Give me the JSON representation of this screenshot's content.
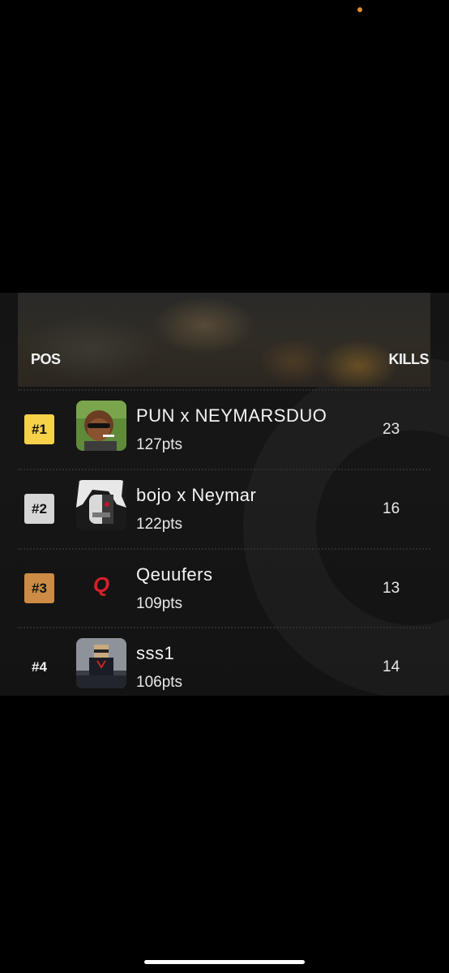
{
  "leaderboard": {
    "header": {
      "pos_label": "POS",
      "kills_label": "KILLS"
    },
    "rows": [
      {
        "rank": "#1",
        "team": "PUN x NEYMARSDUO",
        "points": "127pts",
        "kills": "23",
        "badge": "gold"
      },
      {
        "rank": "#2",
        "team": "bojo x Neymar",
        "points": "122pts",
        "kills": "16",
        "badge": "silver"
      },
      {
        "rank": "#3",
        "team": "Qeuufers",
        "points": "109pts",
        "kills": "13",
        "badge": "bronze"
      },
      {
        "rank": "#4",
        "team": "sss1",
        "points": "106pts",
        "kills": "14",
        "badge": "none"
      }
    ]
  },
  "colors": {
    "gold": "#f6d14a",
    "silver": "#d6d6d6",
    "bronze": "#cc8c45",
    "status_dot": "#e3902d"
  }
}
